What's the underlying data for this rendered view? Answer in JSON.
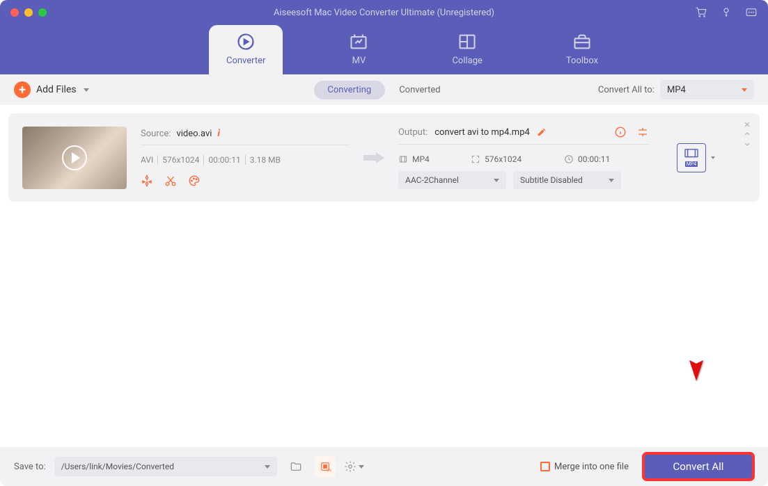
{
  "title": "Aiseesoft Mac Video Converter Ultimate (Unregistered)",
  "nav": {
    "converter": "Converter",
    "mv": "MV",
    "collage": "Collage",
    "toolbox": "Toolbox"
  },
  "toolbar": {
    "add": "Add Files",
    "converting": "Converting",
    "converted": "Converted",
    "convertall_label": "Convert All to:",
    "convertall_value": "MP4"
  },
  "item": {
    "source_label": "Source:",
    "source_name": "video.avi",
    "meta_format": "AVI",
    "meta_res": "576x1024",
    "meta_dur": "00:00:11",
    "meta_size": "3.18 MB",
    "output_label": "Output:",
    "output_name": "convert avi to mp4.mp4",
    "out_format": "MP4",
    "out_res": "576x1024",
    "out_dur": "00:00:11",
    "audio_sel": "AAC-2Channel",
    "sub_sel": "Subtitle Disabled",
    "fmt_badge": "MP4"
  },
  "footer": {
    "saveto": "Save to:",
    "path": "/Users/link/Movies/Converted",
    "merge": "Merge into one file",
    "convert": "Convert All"
  }
}
